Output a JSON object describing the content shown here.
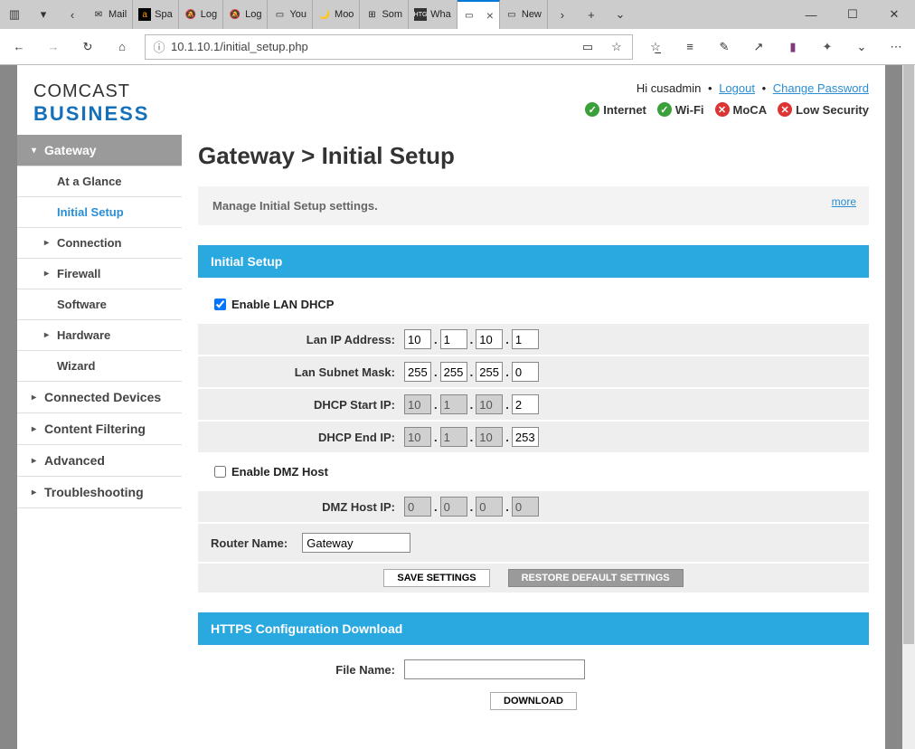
{
  "browser": {
    "tabs": [
      {
        "label": "Mail"
      },
      {
        "label": "Spa"
      },
      {
        "label": "Log"
      },
      {
        "label": "Log"
      },
      {
        "label": "You"
      },
      {
        "label": "Moo"
      },
      {
        "label": "Som"
      },
      {
        "label": "Wha"
      },
      {
        "label": "",
        "active": true
      },
      {
        "label": "New"
      }
    ],
    "url": "10.1.10.1/initial_setup.php"
  },
  "header": {
    "brand1": "COMCAST",
    "brand2": "BUSINESS",
    "greeting": "Hi cusadmin",
    "logout": "Logout",
    "change_pw": "Change Password",
    "statuses": [
      {
        "name": "internet",
        "label": "Internet",
        "ok": true
      },
      {
        "name": "wifi",
        "label": "Wi-Fi",
        "ok": true
      },
      {
        "name": "moca",
        "label": "MoCA",
        "ok": false
      },
      {
        "name": "low-security",
        "label": "Low Security",
        "ok": false
      }
    ]
  },
  "sidebar": {
    "gateway": "Gateway",
    "at_a_glance": "At a Glance",
    "initial_setup": "Initial Setup",
    "connection": "Connection",
    "firewall": "Firewall",
    "software": "Software",
    "hardware": "Hardware",
    "wizard": "Wizard",
    "connected_devices": "Connected Devices",
    "content_filtering": "Content Filtering",
    "advanced": "Advanced",
    "troubleshooting": "Troubleshooting"
  },
  "main": {
    "title": "Gateway > Initial Setup",
    "info_text": "Manage Initial Setup settings.",
    "more": "more",
    "section1_title": "Initial Setup",
    "enable_lan_dhcp": "Enable LAN DHCP",
    "lan_ip_label": "Lan IP Address:",
    "lan_ip": [
      "10",
      "1",
      "10",
      "1"
    ],
    "lan_mask_label": "Lan Subnet Mask:",
    "lan_mask": [
      "255",
      "255",
      "255",
      "0"
    ],
    "dhcp_start_label": "DHCP Start IP:",
    "dhcp_start": [
      "10",
      "1",
      "10",
      "2"
    ],
    "dhcp_end_label": "DHCP End IP:",
    "dhcp_end": [
      "10",
      "1",
      "10",
      "253"
    ],
    "enable_dmz": "Enable DMZ Host",
    "dmz_ip_label": "DMZ Host IP:",
    "dmz_ip": [
      "0",
      "0",
      "0",
      "0"
    ],
    "router_name_label": "Router Name:",
    "router_name": "Gateway",
    "save_settings": "SAVE SETTINGS",
    "restore_defaults": "RESTORE DEFAULT SETTINGS",
    "section2_title": "HTTPS Configuration Download",
    "file_name_label": "File Name:",
    "file_name": "",
    "download": "DOWNLOAD"
  }
}
